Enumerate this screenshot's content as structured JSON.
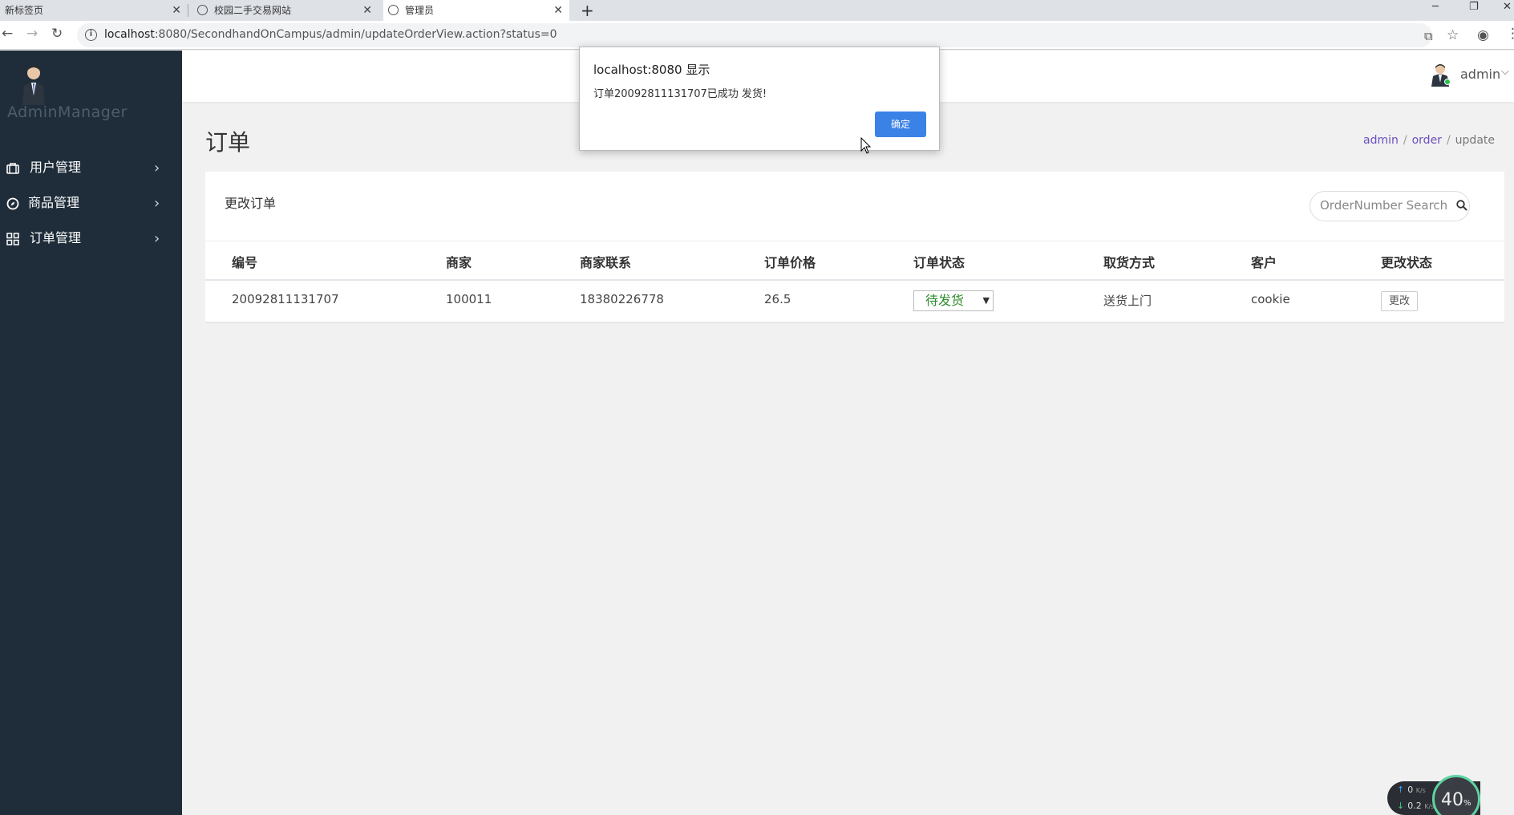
{
  "browser": {
    "tabs": [
      {
        "title": "新标签页",
        "active": false
      },
      {
        "title": "校园二手交易网站",
        "active": false
      },
      {
        "title": "管理员",
        "active": true
      }
    ],
    "url_host": "localhost",
    "url_rest": ":8080/SecondhandOnCampus/admin/updateOrderView.action?status=0",
    "new_tab_icon": "plus-icon"
  },
  "sidebar": {
    "brand": "AdminManager",
    "items": [
      {
        "label": "用户管理",
        "icon": "briefcase-icon"
      },
      {
        "label": "商品管理",
        "icon": "compass-icon"
      },
      {
        "label": "订单管理",
        "icon": "grid-icon"
      }
    ]
  },
  "header": {
    "username": "admin"
  },
  "page": {
    "title": "订单",
    "breadcrumb": [
      "admin",
      "order",
      "update"
    ]
  },
  "card": {
    "title": "更改订单",
    "search_placeholder": "OrderNumber Search",
    "columns": [
      "编号",
      "商家",
      "商家联系",
      "订单价格",
      "订单状态",
      "取货方式",
      "客户",
      "更改状态"
    ],
    "rows": [
      {
        "id": "20092811131707",
        "seller": "100011",
        "seller_contact": "18380226778",
        "price": "26.5",
        "status": "待发货",
        "pickup": "送货上门",
        "customer": "cookie",
        "action": "更改"
      }
    ]
  },
  "dialog": {
    "title": "localhost:8080 显示",
    "message": "订单20092811131707已成功 发货!",
    "ok_label": "确定"
  },
  "speed_widget": {
    "up_value": "0",
    "up_unit": "K/s",
    "down_value": "0.2",
    "down_unit": "K/s",
    "percent": "40",
    "percent_unit": "%"
  },
  "colors": {
    "sidebar_bg": "#1f2d3a",
    "accent_button": "#3b82e6",
    "breadcrumb_link": "#6b4fc4",
    "status_text": "#2e8b2e"
  }
}
